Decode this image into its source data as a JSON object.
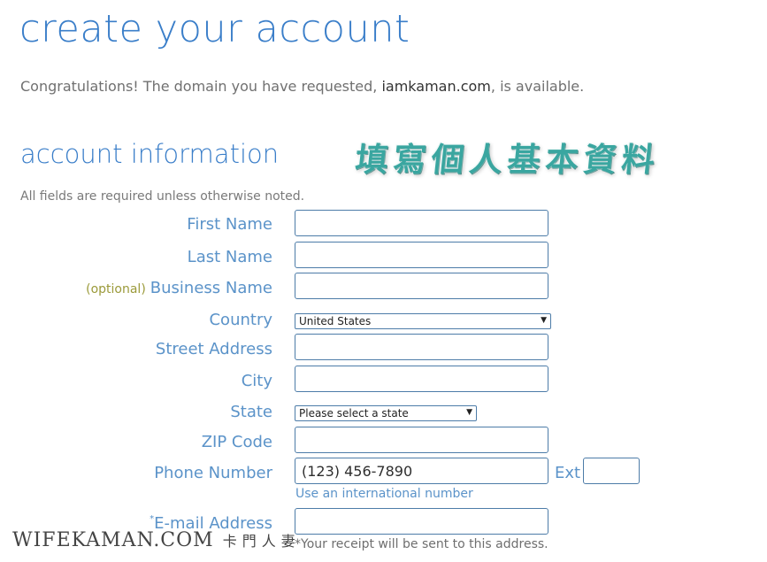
{
  "header": {
    "title": "create your account",
    "congrats_prefix": "Congratulations! The domain you have requested, ",
    "domain": "iamkaman.com",
    "congrats_suffix": ", is available."
  },
  "section": {
    "title": "account information",
    "overlay_text": "填寫個人基本資料",
    "note": "All fields are required unless otherwise noted."
  },
  "form": {
    "first_name_label": "First Name",
    "last_name_label": "Last Name",
    "business_optional": "(optional)",
    "business_label": "Business Name",
    "country_label": "Country",
    "country_value": "United States",
    "street_label": "Street Address",
    "city_label": "City",
    "state_label": "State",
    "state_value": "Please select a state",
    "zip_label": "ZIP Code",
    "phone_label": "Phone Number",
    "phone_value": "(123) 456-7890",
    "ext_label": "Ext",
    "intl_link": "Use an international number",
    "email_asterisk": "*",
    "email_label": "E-mail Address",
    "receipt_note": "*Your receipt will be sent to this address."
  },
  "watermark": {
    "text": "WIFEKAMAN.COM",
    "cn": "卡門人妻"
  },
  "icons": {
    "dropdown": "chevron-down-icon"
  },
  "colors": {
    "accent": "#3a7ec9",
    "label": "#5b93c9",
    "optional": "#9b9a3a",
    "border": "#4d7ca8"
  }
}
